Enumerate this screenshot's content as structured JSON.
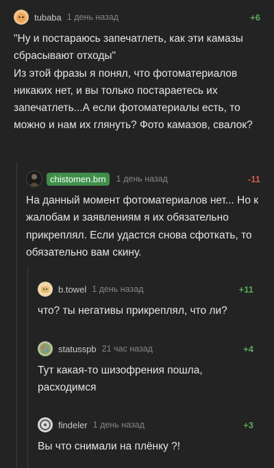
{
  "comments": [
    {
      "author": "tubaba",
      "time": "1 день назад",
      "rating": "+6",
      "text": "\"Ну и постараюсь запечатлеть, как эти камазы сбрасывают отходы\"\nИз этой фразы я понял, что фотоматериалов никаких нет, и вы только постараетесь их запечатлеть...А если фотоматериалы есть, то можно и нам их глянуть? Фото камазов, свалок?",
      "avatar_color": "#f2c28a"
    },
    {
      "author": "chistomen.brn",
      "time": "1 день назад",
      "rating": "-11",
      "text": "На данный момент фотоматериалов нет... Но к жалобам и заявлениям я их обязательно прикреплял. Если удастся снова сфоткать, то обязательно вам скину.",
      "avatar_color": "#1a1a1a",
      "badge_color": "#3f8f4a"
    },
    {
      "author": "b.towel",
      "time": "1 день назад",
      "rating": "+11",
      "text": "что? ты негативы прикреплял, что ли?",
      "avatar_color": "#f0d7a8"
    },
    {
      "author": "statusspb",
      "time": "21 час назад",
      "rating": "+4",
      "text": "Тут какая-то шизофрения пошла, расходимся",
      "avatar_color": "#b7c29a"
    },
    {
      "author": "findeler",
      "time": "1 день назад",
      "rating": "+3",
      "text": "Вы что снимали на плёнку ?!",
      "avatar_color": "#d8d8d8"
    }
  ]
}
